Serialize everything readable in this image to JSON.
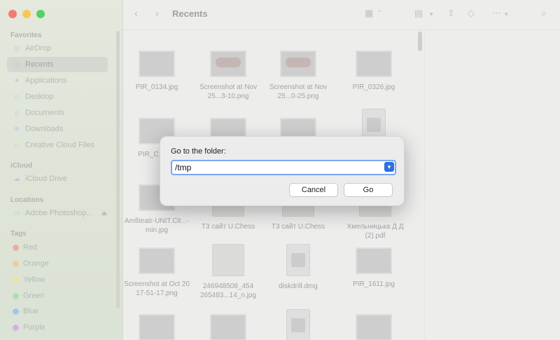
{
  "toolbar": {
    "title": "Recents"
  },
  "sidebar": {
    "sections": [
      {
        "label": "Favorites"
      },
      {
        "label": "iCloud"
      },
      {
        "label": "Locations"
      },
      {
        "label": "Tags"
      }
    ],
    "favorites": [
      "AirDrop",
      "Recents",
      "Applications",
      "Desktop",
      "Documents",
      "Downloads",
      "Creative Cloud Files"
    ],
    "icloud": [
      "iCloud Drive"
    ],
    "locations": [
      "Adobe Photoshop..."
    ],
    "tags": [
      {
        "label": "Red",
        "color": "#e79b93"
      },
      {
        "label": "Orange",
        "color": "#ecc08b"
      },
      {
        "label": "Yellow",
        "color": "#e8dc8a"
      },
      {
        "label": "Green",
        "color": "#9bd79a"
      },
      {
        "label": "Blue",
        "color": "#93b8ea"
      },
      {
        "label": "Purple",
        "color": "#c6a2e3"
      }
    ]
  },
  "files": [
    {
      "name": "PIR_0134.jpg"
    },
    {
      "name": "Screenshot at Nov 25...3-10.png"
    },
    {
      "name": "Screenshot at Nov 25...0-25.png"
    },
    {
      "name": "PIR_0326.jpg"
    },
    {
      "name": "PIR_C"
    },
    {
      "name": "Amfiteatr-UNIT.Cit...-min.jpg"
    },
    {
      "name": "T3 сайт U.Chess"
    },
    {
      "name": "T3 сайт U.Chess"
    },
    {
      "name": "Хмельницька Д Д (2).pdf"
    },
    {
      "name": "Screenshot at Oct 20 17-51-17.png"
    },
    {
      "name": "246948508_454 265483...14_n.jpg"
    },
    {
      "name": "diskdrill.dmg"
    },
    {
      "name": "PIR_1611.jpg"
    }
  ],
  "dialog": {
    "label": "Go to the folder:",
    "path": "/tmp",
    "cancel": "Cancel",
    "go": "Go"
  }
}
